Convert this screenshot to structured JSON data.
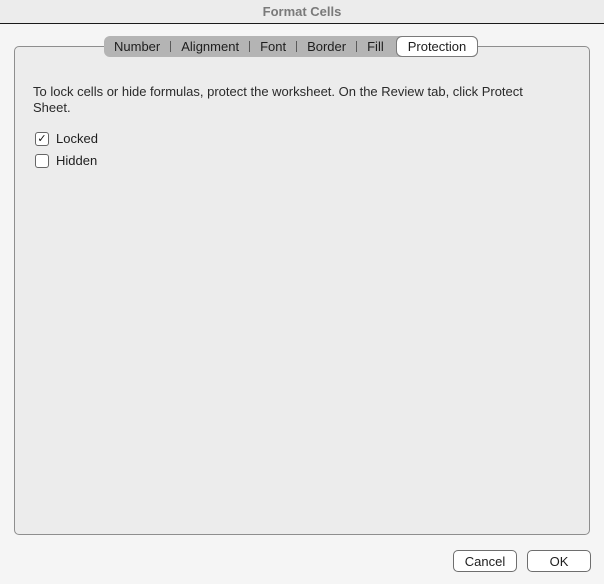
{
  "window": {
    "title": "Format Cells"
  },
  "tabs": [
    {
      "label": "Number",
      "active": false
    },
    {
      "label": "Alignment",
      "active": false
    },
    {
      "label": "Font",
      "active": false
    },
    {
      "label": "Border",
      "active": false
    },
    {
      "label": "Fill",
      "active": false
    },
    {
      "label": "Protection",
      "active": true
    }
  ],
  "protection": {
    "description": "To lock cells or hide formulas, protect the worksheet. On the Review tab, click Protect Sheet.",
    "locked": {
      "label": "Locked",
      "checked": true,
      "glyph": "✓"
    },
    "hidden": {
      "label": "Hidden",
      "checked": false,
      "glyph": ""
    }
  },
  "buttons": {
    "cancel": "Cancel",
    "ok": "OK"
  }
}
